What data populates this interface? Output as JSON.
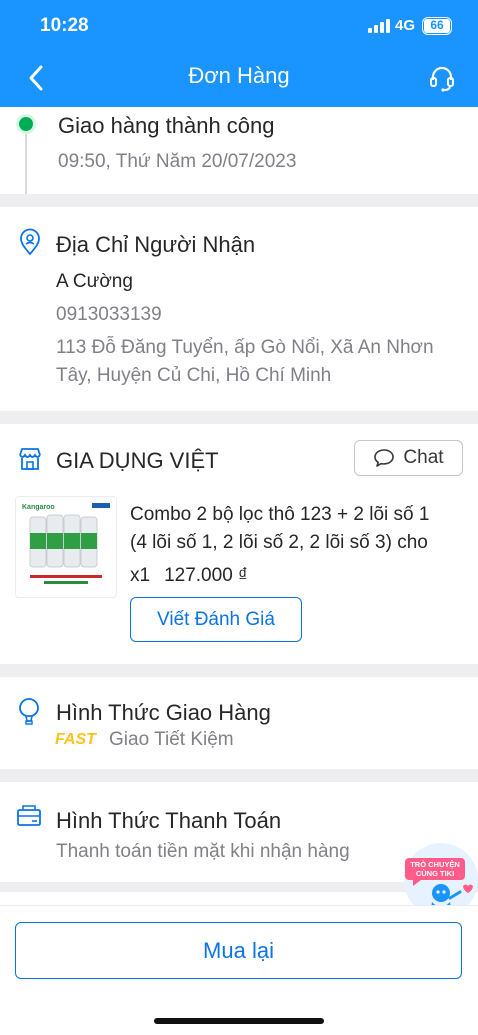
{
  "status_bar": {
    "time": "10:28",
    "network": "4G",
    "battery": "66"
  },
  "nav": {
    "title": "Đơn Hàng",
    "back_icon": "back-arrow-icon",
    "support_icon": "headset-icon"
  },
  "tracking": {
    "status": "Giao hàng thành công",
    "time": "09:50, Thứ Năm 20/07/2023",
    "dot_color": "#00ab56"
  },
  "address": {
    "title": "Địa Chỉ Người Nhận",
    "name": "A Cường",
    "phone": "0913033139",
    "line1": "113 Đỗ Đăng Tuyển, ấp Gò Nổi, Xã An Nhơn",
    "line2": "Tây, Huyện Củ Chi, Hồ Chí Minh"
  },
  "shop": {
    "name": "GIA DỤNG VIỆT",
    "chat_label": "Chat"
  },
  "product": {
    "name_line1": "Combo 2 bộ lọc thô 123 + 2 lõi số 1",
    "name_line2": "(4 lõi số 1, 2 lõi số 2, 2 lõi số 3) cho",
    "quantity": "x1",
    "price": "127.000 ₫",
    "review_label": "Viết Đánh Giá"
  },
  "shipping": {
    "title": "Hình Thức Giao Hàng",
    "badge": "FAST",
    "method": "Giao Tiết Kiệm"
  },
  "payment": {
    "title": "Hình Thức Thanh Toán",
    "method": "Thanh toán tiền mặt khi nhận hàng"
  },
  "floating_chat": {
    "label_line1": "TRÒ CHUYỆN",
    "label_line2": "CÙNG TIKI"
  },
  "actions": {
    "rebuy_label": "Mua lại"
  },
  "colors": {
    "primary": "#1a94ff",
    "link": "#0b74e5",
    "success": "#00ab56",
    "fast": "#ffc31f"
  }
}
